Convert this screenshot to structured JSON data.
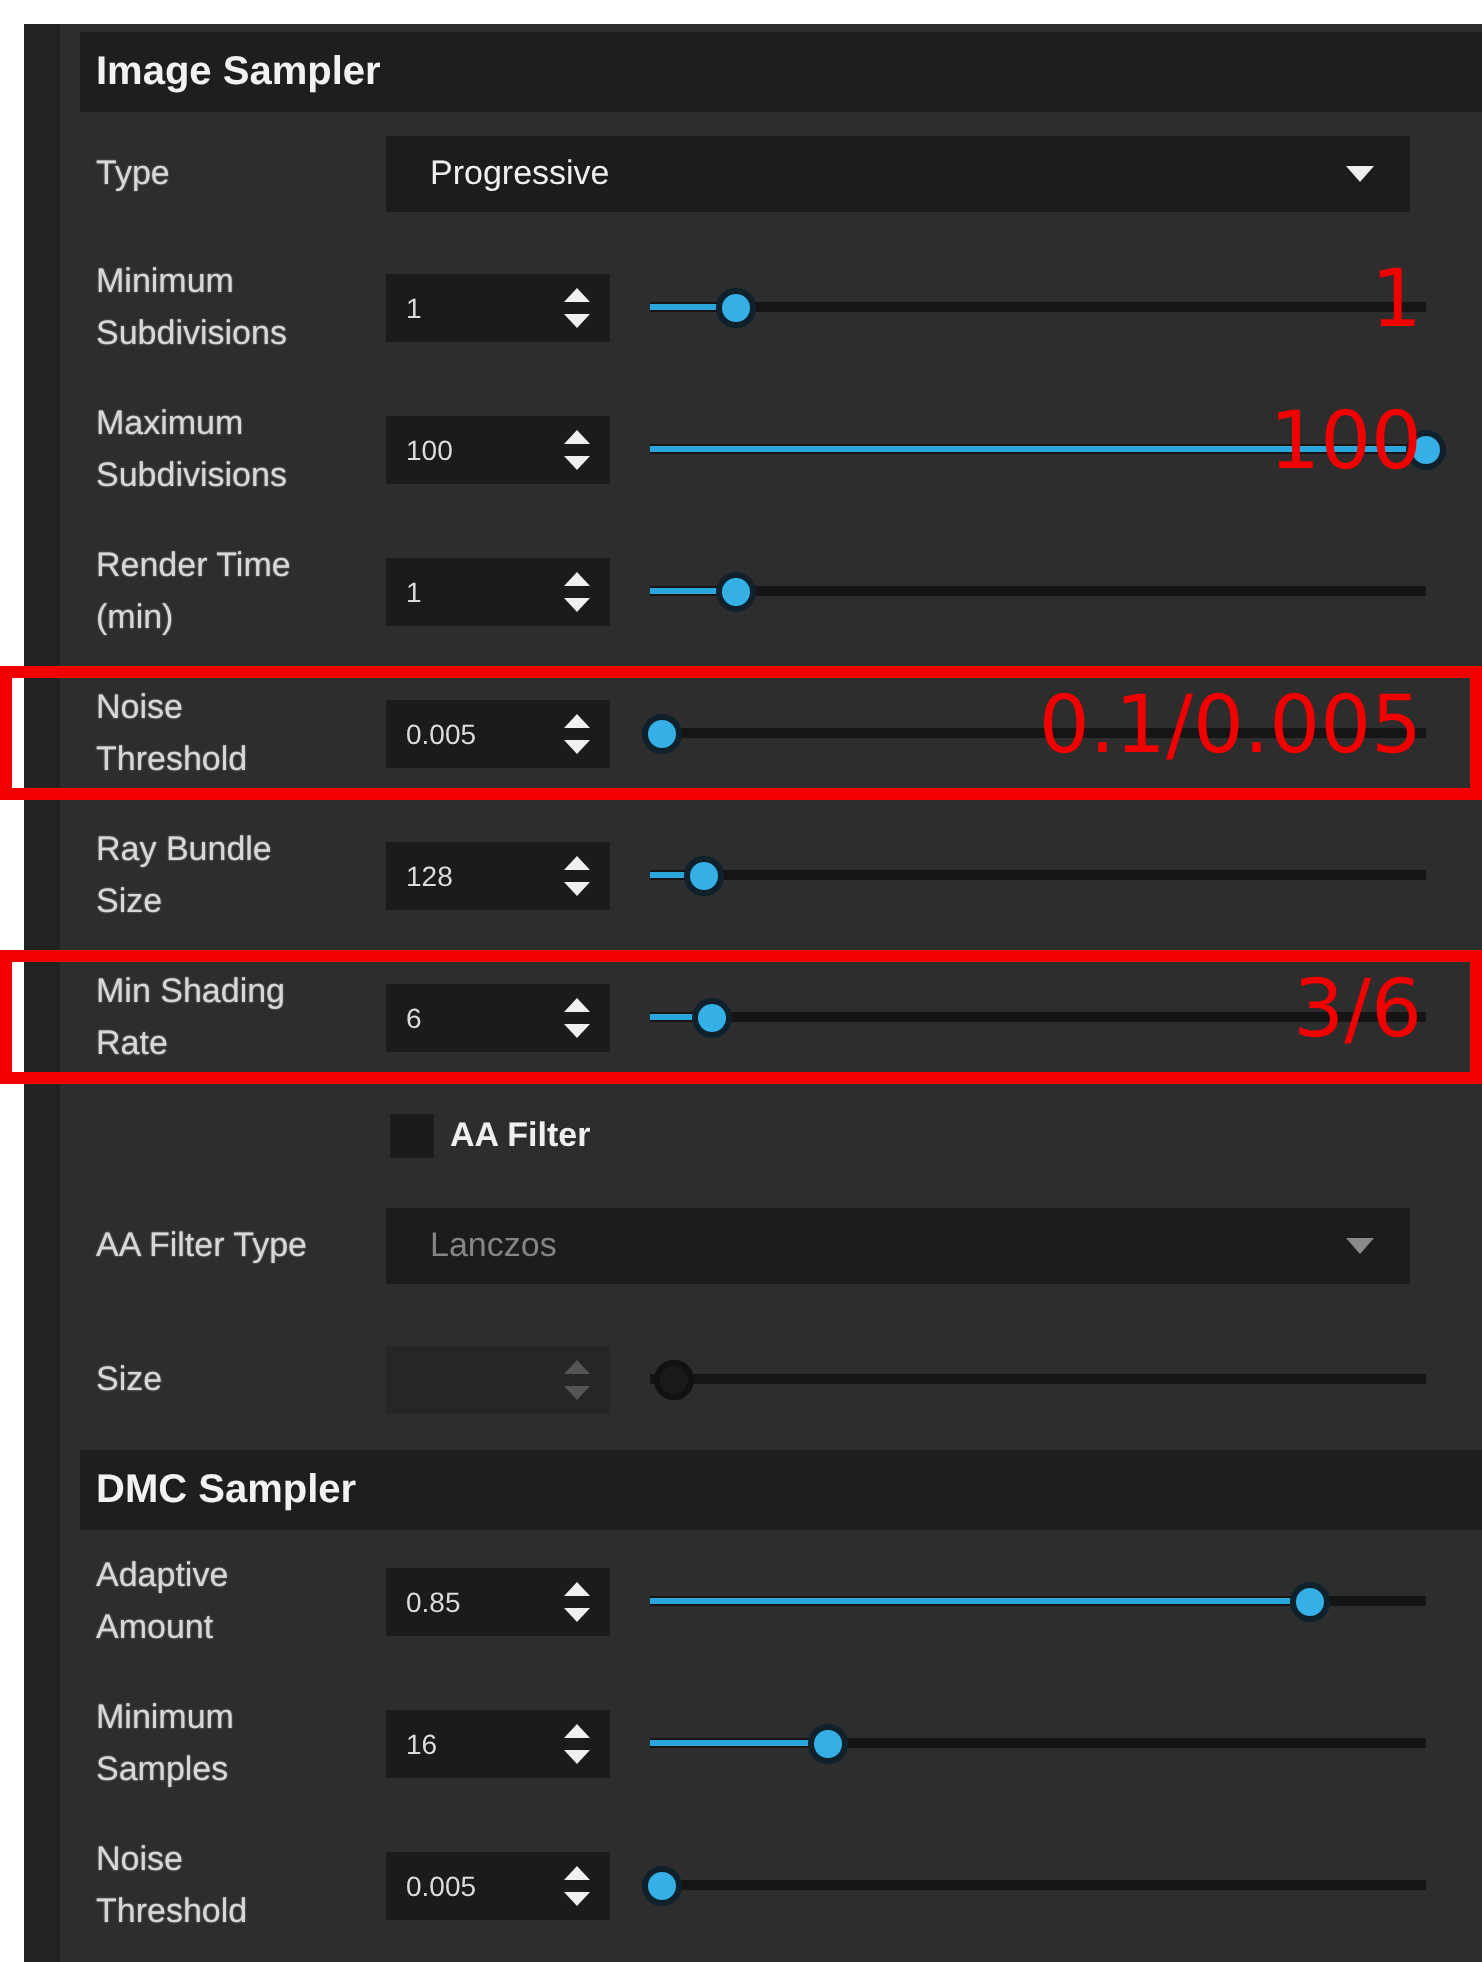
{
  "sections": [
    {
      "title": "Image Sampler",
      "rows": [
        {
          "kind": "dropdown",
          "label": "Type",
          "value": "Progressive",
          "disabled": false
        },
        {
          "kind": "spinner",
          "label": "Minimum Subdivisions",
          "value": "1",
          "level": 0.11,
          "disabled": false,
          "highlighted": false,
          "annotation": "1"
        },
        {
          "kind": "spinner",
          "label": "Maximum Subdivisions",
          "value": "100",
          "level": 1,
          "disabled": false,
          "highlighted": false,
          "annotation": "100"
        },
        {
          "kind": "spinner",
          "label": "Render Time (min)",
          "value": "1",
          "level": 0.11,
          "disabled": false,
          "highlighted": false
        },
        {
          "kind": "spinner",
          "label": "Noise Threshold",
          "value": "0.005",
          "level": 0.015,
          "disabled": false,
          "highlighted": true,
          "annotation": "0.1/0.005"
        },
        {
          "kind": "spinner",
          "label": "Ray Bundle Size",
          "value": "128",
          "level": 0.07,
          "disabled": false,
          "highlighted": false
        },
        {
          "kind": "spinner",
          "label": "Min Shading Rate",
          "value": "6",
          "level": 0.08,
          "disabled": false,
          "highlighted": true,
          "annotation": "3/6"
        },
        {
          "kind": "checkbox",
          "label": "AA Filter",
          "checked": false
        },
        {
          "kind": "dropdown",
          "label": "AA Filter Type",
          "value": "Lanczos",
          "disabled": true
        },
        {
          "kind": "spinner",
          "label": "Size",
          "level": 0.03,
          "disabled": true,
          "highlighted": false
        }
      ]
    },
    {
      "title": "DMC Sampler",
      "rows": [
        {
          "kind": "spinner",
          "label": "Adaptive Amount",
          "value": "0.85",
          "level": 0.85,
          "disabled": false,
          "highlighted": false
        },
        {
          "kind": "spinner",
          "label": "Minimum Samples",
          "value": "16",
          "level": 0.23,
          "disabled": false,
          "highlighted": false
        },
        {
          "kind": "spinner",
          "label": "Noise Threshold",
          "value": "0.005",
          "level": 0.015,
          "disabled": false,
          "highlighted": false
        }
      ]
    }
  ]
}
